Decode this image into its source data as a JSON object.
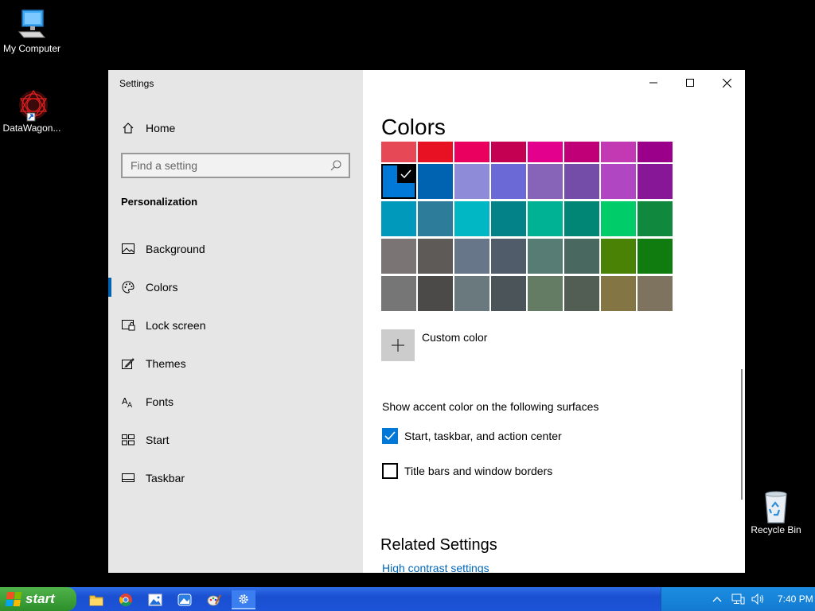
{
  "desktop": {
    "icons": [
      {
        "label": "My Computer",
        "icon": "computer-icon"
      },
      {
        "label": "DataWagon...",
        "icon": "datawagon-app-icon"
      },
      {
        "label": "Recycle Bin",
        "icon": "recycle-bin-icon"
      }
    ]
  },
  "window": {
    "title": "Settings",
    "controls": [
      "minimize",
      "maximize",
      "close"
    ]
  },
  "sidebar": {
    "home_label": "Home",
    "search_placeholder": "Find a setting",
    "section_heading": "Personalization",
    "items": [
      {
        "label": "Background",
        "icon": "picture-icon"
      },
      {
        "label": "Colors",
        "icon": "palette-icon",
        "active": true
      },
      {
        "label": "Lock screen",
        "icon": "lock-screen-icon"
      },
      {
        "label": "Themes",
        "icon": "themes-brush-icon"
      },
      {
        "label": "Fonts",
        "icon": "fonts-icon"
      },
      {
        "label": "Start",
        "icon": "start-grid-icon"
      },
      {
        "label": "Taskbar",
        "icon": "taskbar-icon"
      }
    ]
  },
  "content": {
    "title": "Colors",
    "swatch_rows": [
      [
        "#e74856",
        "#e81123",
        "#ea005e",
        "#c30052",
        "#e3008c",
        "#bf0077",
        "#c239b3",
        "#9a0089"
      ],
      [
        "#0078d7",
        "#0063b1",
        "#8e8cd8",
        "#6b69d6",
        "#8764b8",
        "#744da9",
        "#b146c2",
        "#881798"
      ],
      [
        "#0099bc",
        "#2d7d9a",
        "#00b7c3",
        "#038387",
        "#00b294",
        "#018574",
        "#00cc6a",
        "#10893e"
      ],
      [
        "#7a7574",
        "#5d5a58",
        "#68768a",
        "#515c6b",
        "#567c73",
        "#486860",
        "#498205",
        "#107c10"
      ],
      [
        "#767676",
        "#4c4a48",
        "#69797e",
        "#4a5459",
        "#647c64",
        "#525e54",
        "#847545",
        "#7e735f"
      ]
    ],
    "selected_swatch": {
      "row": 1,
      "col": 0
    },
    "custom_color_label": "Custom color",
    "surfaces_label": "Show accent color on the following surfaces",
    "checkboxes": [
      {
        "label": "Start, taskbar, and action center",
        "checked": true
      },
      {
        "label": "Title bars and window borders",
        "checked": false
      }
    ],
    "related_heading": "Related Settings",
    "related_link": "High contrast settings"
  },
  "taskbar": {
    "start_label": "start",
    "apps": [
      "file-explorer-icon",
      "chrome-icon",
      "photos-icon",
      "gallery-icon",
      "paint-icon",
      "settings-gear-icon"
    ],
    "active_app": "settings-gear-icon",
    "tray_icons": [
      "chevron-up-icon",
      "network-icon",
      "volume-icon"
    ],
    "clock": "7:40 PM"
  },
  "colors": {
    "accent": "#0078d7",
    "sidebar_bg": "#e6e6e6",
    "taskbar_blue": "#1c54d8",
    "start_green": "#3a9c36"
  }
}
